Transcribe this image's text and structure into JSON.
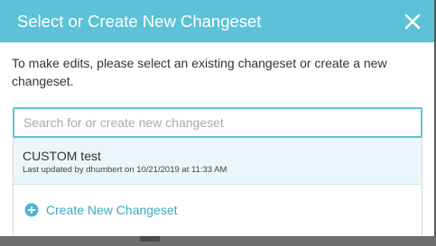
{
  "dialog": {
    "title": "Select or Create New Changeset",
    "close_icon": "close-icon",
    "instructions": "To make edits, please select an existing changeset or create a new changeset."
  },
  "search": {
    "value": "",
    "placeholder": "Search for or create new changeset"
  },
  "changesets": [
    {
      "name": "CUSTOM test",
      "meta": "Last updated by dhumbert on 10/21/2019 at 11:33 AM"
    }
  ],
  "create": {
    "icon": "plus-circle-icon",
    "label": "Create New Changeset"
  },
  "colors": {
    "accent": "#5bc2d8",
    "link": "#3aa9c4",
    "item_highlight": "#eaf6fa"
  }
}
